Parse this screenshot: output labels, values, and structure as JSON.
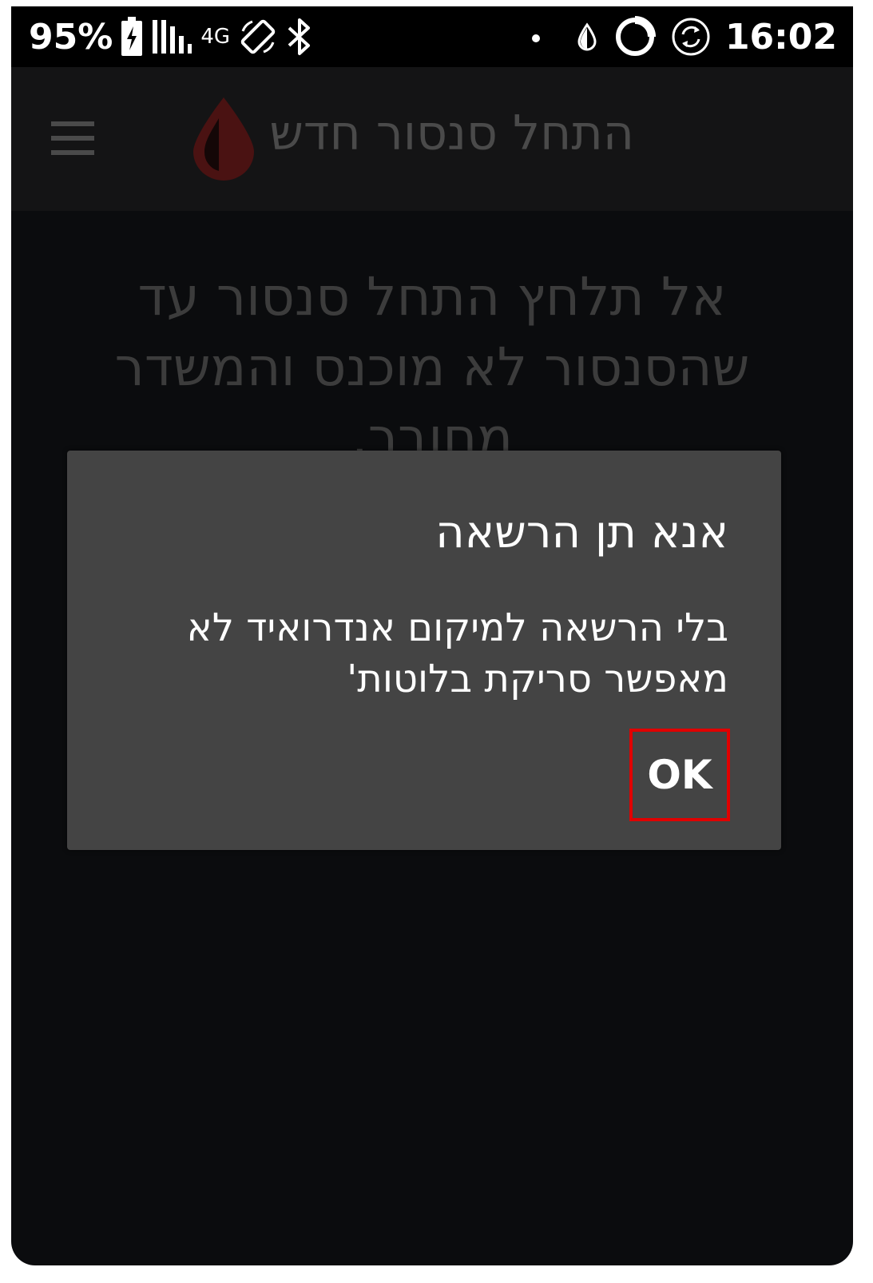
{
  "status_bar": {
    "battery_percent": "95%",
    "network": "4G",
    "time": "16:02",
    "icons": [
      "battery-charging-icon",
      "signal-icon",
      "rotate-icon",
      "bluetooth-icon",
      "dot-icon",
      "drop-icon",
      "circle-status-icon",
      "sync-icon"
    ]
  },
  "app_bar": {
    "title": "התחל סנסור חדש",
    "menu_icon": "hamburger-menu-icon",
    "logo_icon": "blood-drop-icon",
    "logo_color": "#6e1a1a"
  },
  "main": {
    "message": "אל תלחץ התחל סנסור עד שהסנסור לא מוכנס והמשדר מחובר."
  },
  "dialog": {
    "title": "אנא תן הרשאה",
    "message": "בלי הרשאה למיקום אנדרואיד לא מאפשר סריקת בלוטות'",
    "ok_label": "OK",
    "highlight_color": "#e00000"
  }
}
